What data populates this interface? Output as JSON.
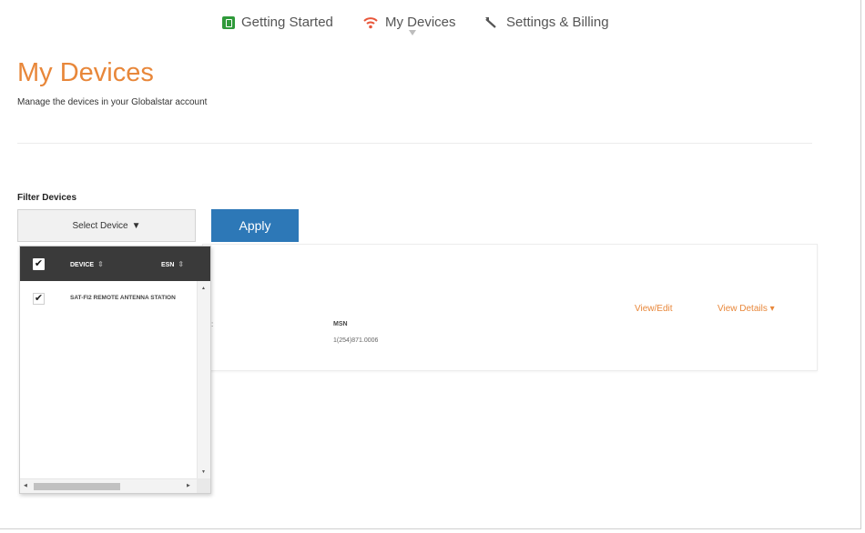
{
  "nav": {
    "items": [
      {
        "label": "Getting Started",
        "icon": "getting-started-icon"
      },
      {
        "label": "My Devices",
        "icon": "wifi-icon"
      },
      {
        "label": "Settings & Billing",
        "icon": "wrench-icon"
      }
    ],
    "active": "My Devices"
  },
  "header": {
    "title": "My Devices",
    "subtitle": "Manage the devices in your Globalstar account"
  },
  "filter": {
    "label": "Filter Devices",
    "select_label": "Select Device",
    "select_caret": "▼",
    "apply_label": "Apply"
  },
  "dropdown": {
    "columns": [
      "DEVICE",
      "ESN"
    ],
    "rows": [
      {
        "checked": true,
        "device": "SAT-FI2 REMOTE ANTENNA STATION"
      }
    ]
  },
  "card": {
    "colon": ":",
    "msn_label": "MSN",
    "msn_value": "1(254)871.0006",
    "view_edit": "View/Edit",
    "view_details": "View Details",
    "view_details_caret": "▾"
  },
  "colors": {
    "accent_orange": "#e8873a",
    "apply_blue": "#2d78b7",
    "dropdown_header": "#3a3a3a",
    "getting_started_green": "#2f9a3a"
  }
}
